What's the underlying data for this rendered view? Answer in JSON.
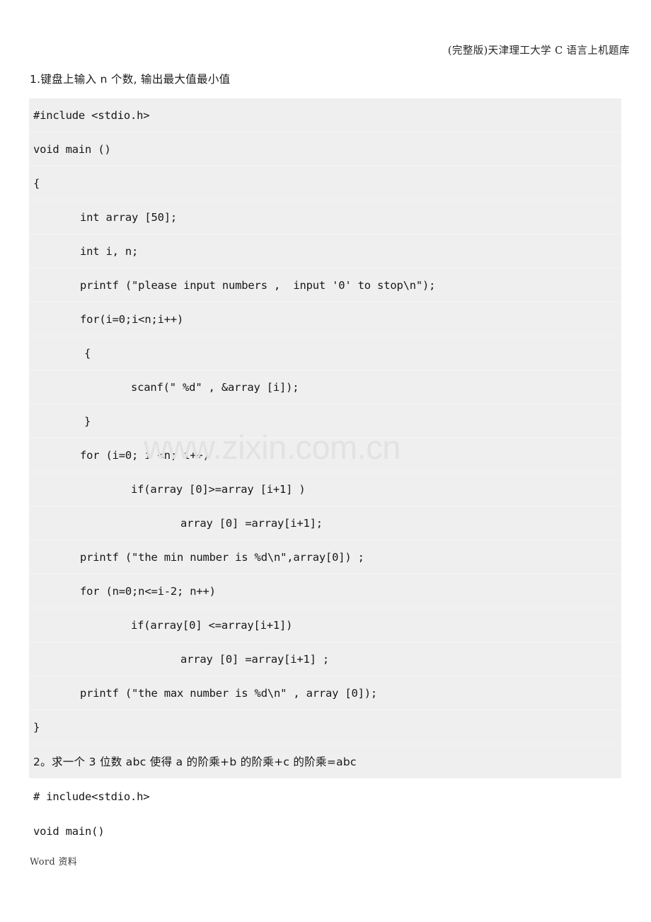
{
  "document": {
    "header_text": "(完整版)天津理工大学 C 语言上机题库",
    "footer_text": "Word 资料",
    "watermark_text": "www.zixin.com.cn",
    "background_color": "#ffffff",
    "code_block_color": "#efefef",
    "text_color": "#1a1a1a",
    "watermark_color": "#e2e2e2"
  },
  "questions": [
    {
      "heading": "1.键盘上输入 n 个数, 输出最大值最小值"
    },
    {
      "heading": "2。求一个 3 位数 abc 使得 a 的阶乘+b 的阶乘+c 的阶乘=abc"
    }
  ],
  "code_block_1": {
    "lines": [
      {
        "indent": 0,
        "text": "#include <stdio.h>"
      },
      {
        "indent": 0,
        "text": "void main ()"
      },
      {
        "indent": 0,
        "text": "{"
      },
      {
        "indent": 1,
        "text": "int array [50];"
      },
      {
        "indent": 1,
        "text": "int i, n;"
      },
      {
        "indent": 1,
        "text": "printf (\"please input numbers ,  input '0' to stop\\n\");"
      },
      {
        "indent": 1,
        "text": "for(i=0;i<n;i++)"
      },
      {
        "indent": 2,
        "text": "{"
      },
      {
        "indent": 3,
        "text": "scanf(\" %d\" , &array [i]);"
      },
      {
        "indent": 2,
        "text": "}"
      },
      {
        "indent": 1,
        "text": "for (i=0; i <n; i++)"
      },
      {
        "indent": 3,
        "text": "if(array [0]>=array [i+1] )"
      },
      {
        "indent": 4,
        "text": "array [0] =array[i+1];"
      },
      {
        "indent": 1,
        "text": "printf (\"the min number is %d\\n\",array[0]) ;"
      },
      {
        "indent": 1,
        "text": "for (n=0;n<=i-2; n++)"
      },
      {
        "indent": 3,
        "text": "if(array[0] <=array[i+1])"
      },
      {
        "indent": 4,
        "text": "array [0] =array[i+1] ;"
      },
      {
        "indent": 1,
        "text": "printf (\"the max number is %d\\n\" , array [0]);"
      },
      {
        "indent": 0,
        "text": "}"
      }
    ]
  },
  "code_block_2": {
    "lines": [
      {
        "indent": 0,
        "text": "# include<stdio.h>"
      },
      {
        "indent": 0,
        "text": "void main()"
      }
    ]
  }
}
